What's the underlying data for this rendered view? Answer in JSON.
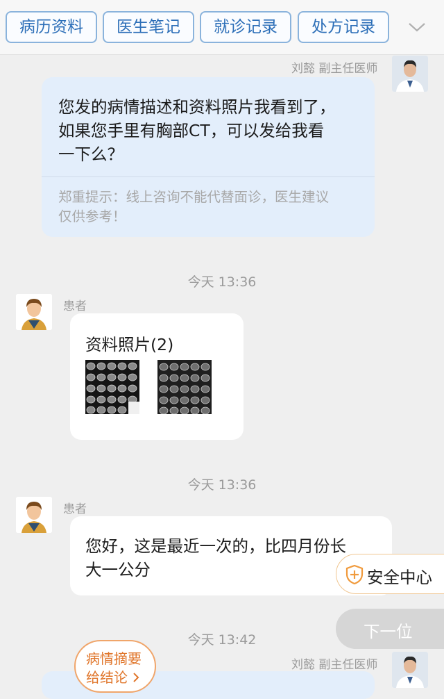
{
  "tabs": [
    {
      "label": "病历资料"
    },
    {
      "label": "医生笔记"
    },
    {
      "label": "就诊记录"
    },
    {
      "label": "处方记录"
    }
  ],
  "messages": [
    {
      "sender": "刘懿 副主任医师",
      "text_lines": [
        "您发的病情描述和资料照片我看到了，",
        "如果您手里有胸部CT，可以发给我看",
        "一下么？"
      ],
      "notice_lines": [
        "郑重提示：线上咨询不能代替面诊，医生建议",
        "仅供参考！"
      ]
    },
    {
      "timestamp": "今天 13:36",
      "sender": "患者",
      "title": "资料照片(2)"
    },
    {
      "timestamp": "今天 13:36",
      "sender": "患者",
      "text_lines": [
        "您好，这是最近一次的，比四月份长",
        "大一公分"
      ]
    },
    {
      "timestamp": "今天 13:42",
      "sender": "刘懿 副主任医师"
    }
  ],
  "floating": {
    "safety_label": "安全中心",
    "next_label": "下一位",
    "summary_line1": "病情摘要",
    "summary_line2": "给结论"
  },
  "icons": {
    "dropdown": "chevron-down-icon",
    "safety": "shield-plus-icon",
    "summary_arrow": "chevron-right-icon"
  },
  "colors": {
    "tab_border": "#8ab3dc",
    "tab_text": "#2d6fb8",
    "doctor_bubble": "#e3eefb",
    "summary_orange": "#e0762b",
    "safety_orange": "#f0a56a"
  }
}
